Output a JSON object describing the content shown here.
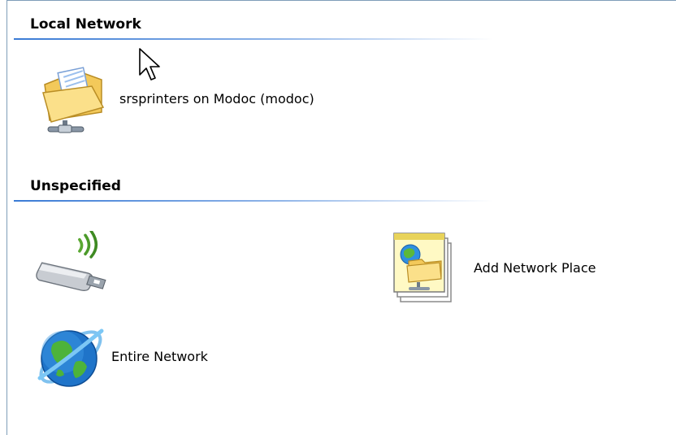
{
  "groups": [
    {
      "header": "Local Network",
      "items": [
        {
          "label": "srsprinters on Modoc (modoc)",
          "icon": "network-share-folder-icon"
        }
      ]
    },
    {
      "header": "Unspecified",
      "items": [
        {
          "label": "",
          "icon": "wireless-usb-adapter-icon"
        },
        {
          "label": "Add Network Place",
          "icon": "add-network-place-wizard-icon"
        },
        {
          "label": "Entire Network",
          "icon": "entire-network-globe-icon"
        }
      ]
    }
  ],
  "colors": {
    "header_line": "#3a7bd5",
    "pane_border": "#7f9db9"
  }
}
